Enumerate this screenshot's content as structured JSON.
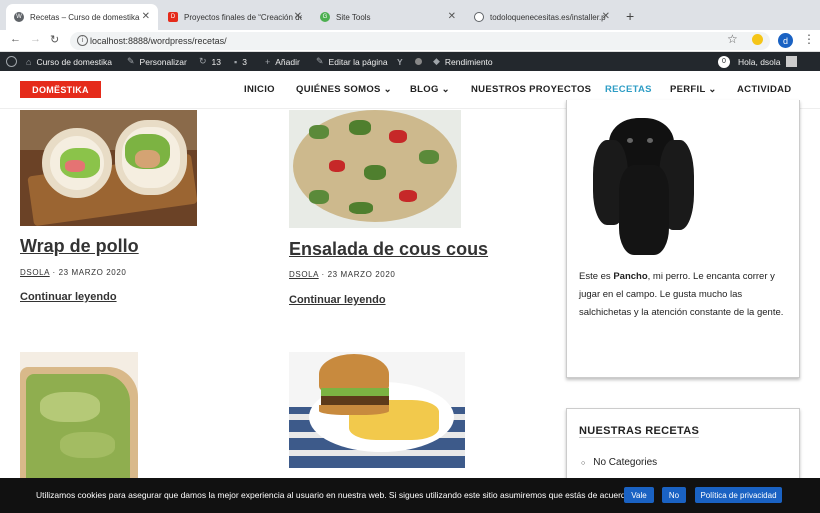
{
  "browser": {
    "tabs": [
      {
        "title": "Recetas – Curso de domestika",
        "active": true,
        "favicon_color": "#5f6368"
      },
      {
        "title": "Proyectos finales de “Creación de",
        "active": false,
        "favicon_color": "#e52b1b"
      },
      {
        "title": "Site Tools",
        "active": false,
        "favicon_color": "#4caf50"
      },
      {
        "title": "todoloquenecesitas.es/installer.p",
        "active": false,
        "favicon_color": "#5f6368"
      }
    ],
    "url": "localhost:8888/wordpress/recetas/",
    "profile_initial": "d"
  },
  "adminbar": {
    "site": "Curso de domestika",
    "customize": "Personalizar",
    "updates": "13",
    "comments": "3",
    "add_new": "Añadir",
    "edit_page": "Editar la página",
    "performance": "Rendimiento",
    "notifications": "0",
    "greeting": "Hola, dsola"
  },
  "header": {
    "logo": "DOMËSTIKA",
    "nav": [
      "INICIO",
      "QUIÉNES SOMOS",
      "BLOG",
      "NUESTROS PROYECTOS",
      "RECETAS",
      "PERFIL",
      "ACTIVIDAD"
    ],
    "current": "RECETAS"
  },
  "posts": [
    {
      "title": "Wrap de pollo",
      "author": "DSOLA",
      "date": "23 MARZO 2020",
      "more": "Continuar leyendo"
    },
    {
      "title": "Ensalada de cous cous",
      "author": "DSOLA",
      "date": "23 MARZO 2020",
      "more": "Continuar leyendo"
    }
  ],
  "sidebar": {
    "about_pre": "Este es ",
    "about_name": "Pancho",
    "about_post": ", mi perro. Le encanta correr y jugar en el campo. Le gusta mucho las salchichetas y la atención constante de la gente.",
    "recipes_title": "NUESTRAS RECETAS",
    "recipes_item": "No Categories"
  },
  "cookie": {
    "text": "Utilizamos cookies para asegurar que damos la mejor experiencia al usuario en nuestra web. Si sigues utilizando este sitio asumiremos que estás de acuerdo.",
    "accept": "Vale",
    "decline": "No",
    "policy": "Política de privacidad"
  },
  "colors": {
    "brand": "#e52b1b",
    "accent": "#2e9dc5",
    "admin_bg": "#23282d",
    "cookie_btn": "#1a62c3"
  }
}
